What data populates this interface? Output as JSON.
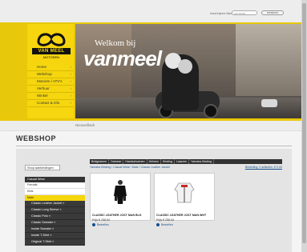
{
  "newsletter": {
    "label": "Inschrijven Nieuwsbrief:",
    "placeholder": "uw email",
    "button": "versturen"
  },
  "logo": {
    "brand": "VAN MEEL",
    "sub": "MOTOREN"
  },
  "nav": [
    {
      "label": "Home"
    },
    {
      "label": "Webshop"
    },
    {
      "label": "Motoren / ATV's"
    },
    {
      "label": "Verhuur"
    },
    {
      "label": "Winkel"
    },
    {
      "label": "Contact & info"
    }
  ],
  "hero": {
    "welcome": "Welkom bij",
    "brand": "vanmeel"
  },
  "breadcrumb": "Nieuwsflash",
  "shop": {
    "title": "WEBSHOP",
    "search_button": "Shop aanbiedingen"
  },
  "categories": [
    {
      "label": "Casual Wear",
      "style": "head"
    },
    {
      "label": "Female",
      "style": "white"
    },
    {
      "label": "Kids",
      "style": "white"
    },
    {
      "label": "Male",
      "style": "yellow"
    },
    {
      "label": "Classic Leather Jacket »",
      "style": "sub"
    },
    {
      "label": "Classic Long Sleeve »",
      "style": "sub"
    },
    {
      "label": "Classic Polo »",
      "style": "sub"
    },
    {
      "label": "Classic Sweater »",
      "style": "sub"
    },
    {
      "label": "Inside Sweater »",
      "style": "sub"
    },
    {
      "label": "Inside T-Shirt »",
      "style": "sub"
    },
    {
      "label": "Original T-Shirt »",
      "style": "sub"
    }
  ],
  "tabs": [
    "Bridgestone",
    "Dainese",
    "Handschoenen",
    "Helmen",
    "Kleding",
    "Laarzen",
    "Yamaha Kleding"
  ],
  "crumb2": "Yamaha Kleding / Casual Wear / Male / Classic Leather Jacket",
  "cart": "Bestelling: 0 artikelen, € 0,00",
  "products": [
    {
      "name": "CLASSIC LEATHER JCKT MAN BLK",
      "price": "Prijs € 258,94",
      "info": "Bestellen",
      "color": "black"
    },
    {
      "name": "CLASSIC LEATHER JCKT MAN WHT",
      "price": "Prijs € 258,94",
      "info": "Bestellen",
      "color": "white"
    }
  ]
}
